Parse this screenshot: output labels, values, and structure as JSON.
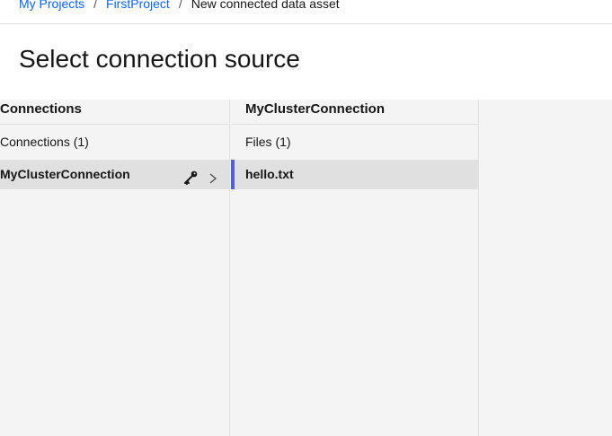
{
  "breadcrumb": {
    "items": [
      {
        "label": "My Projects"
      },
      {
        "label": "FirstProject"
      }
    ],
    "separator": "/",
    "current": "New connected data asset"
  },
  "page": {
    "title": "Select connection source"
  },
  "columns": {
    "connections": {
      "header": "Connections",
      "count_label": "Connections (1)",
      "rows": [
        {
          "label": "MyClusterConnection",
          "icons": [
            "key-icon",
            "chevron-right-icon"
          ]
        }
      ]
    },
    "cluster": {
      "header": "MyClusterConnection",
      "count_label": "Files (1)",
      "rows": [
        {
          "label": "hello.txt"
        }
      ]
    }
  },
  "colors": {
    "link": "#0f62fe",
    "selection_bar": "#4f5fe8",
    "panel_bg": "#f4f4f4",
    "selected_row_bg": "#e0e0e0"
  }
}
